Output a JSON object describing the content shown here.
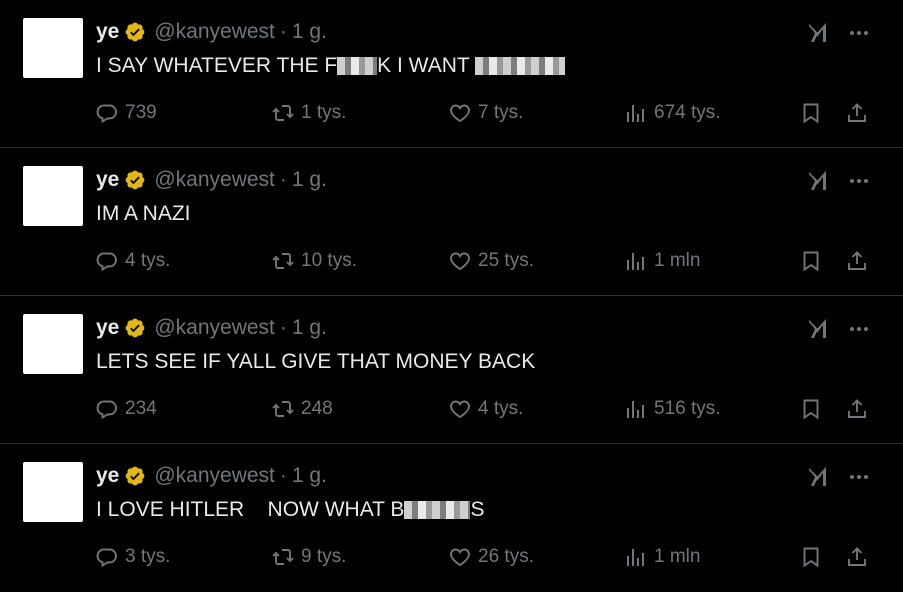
{
  "tweets": [
    {
      "name": "ye",
      "handle": "@kanyewest",
      "separator": "·",
      "time": "1 g.",
      "text_parts": [
        "I SAY WHATEVER THE F",
        "",
        "K I WANT ",
        ""
      ],
      "blur_widths": [
        0,
        40,
        0,
        90
      ],
      "replies": "739",
      "retweets": "1 tys.",
      "likes": "7 tys.",
      "views": "674 tys."
    },
    {
      "name": "ye",
      "handle": "@kanyewest",
      "separator": "·",
      "time": "1 g.",
      "text_parts": [
        "IM A NAZI"
      ],
      "blur_widths": [
        0
      ],
      "replies": "4 tys.",
      "retweets": "10 tys.",
      "likes": "25 tys.",
      "views": "1 mln"
    },
    {
      "name": "ye",
      "handle": "@kanyewest",
      "separator": "·",
      "time": "1 g.",
      "text_parts": [
        "LETS SEE IF YALL GIVE THAT MONEY BACK"
      ],
      "blur_widths": [
        0
      ],
      "replies": "234",
      "retweets": "248",
      "likes": "4 tys.",
      "views": "516 tys."
    },
    {
      "name": "ye",
      "handle": "@kanyewest",
      "separator": "·",
      "time": "1 g.",
      "text_parts": [
        "I LOVE HITLER    NOW WHAT B",
        "",
        "S"
      ],
      "blur_widths": [
        0,
        66,
        0
      ],
      "replies": "3 tys.",
      "retweets": "9 tys.",
      "likes": "26 tys.",
      "views": "1 mln"
    }
  ],
  "icons": {
    "reply": "reply-icon",
    "retweet": "retweet-icon",
    "like": "heart-icon",
    "views": "views-icon",
    "bookmark": "bookmark-icon",
    "share": "share-icon",
    "grok": "grok-icon",
    "more": "more-icon",
    "verified": "verified-badge-icon"
  },
  "colors": {
    "background": "#000000",
    "text": "#e7e9ea",
    "muted": "#71767b",
    "verified": "#e2b719",
    "divider": "#2f3336"
  }
}
